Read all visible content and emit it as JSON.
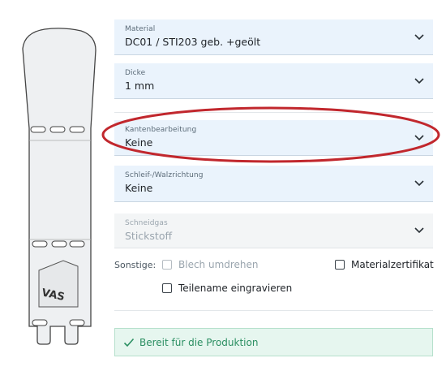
{
  "part_preview": {
    "engraving_text": "VAS"
  },
  "fields": [
    {
      "label": "Material",
      "value": "DC01 / STI203 geb. +geölt",
      "disabled": false
    },
    {
      "label": "Dicke",
      "value": "1 mm",
      "disabled": false
    },
    {
      "label": "Kantenbearbeitung",
      "value": "Keine",
      "disabled": false
    },
    {
      "label": "Schleif-/Walzrichtung",
      "value": "Keine",
      "disabled": false
    },
    {
      "label": "Schneidgas",
      "value": "Stickstoff",
      "disabled": true
    }
  ],
  "options": {
    "label": "Sonstige:",
    "blech_umdrehen": {
      "label": "Blech umdrehen",
      "checked": false,
      "disabled": true
    },
    "materialzertifikat": {
      "label": "Materialzertifikat",
      "checked": false,
      "disabled": false
    },
    "teilename": {
      "label": "Teilename eingravieren",
      "checked": false,
      "disabled": false
    }
  },
  "status": {
    "text": "Bereit für die Produktion"
  },
  "colors": {
    "field_bg": "#eaf3fc",
    "highlight_oval": "#c1272d",
    "status_green": "#2b8f62"
  }
}
